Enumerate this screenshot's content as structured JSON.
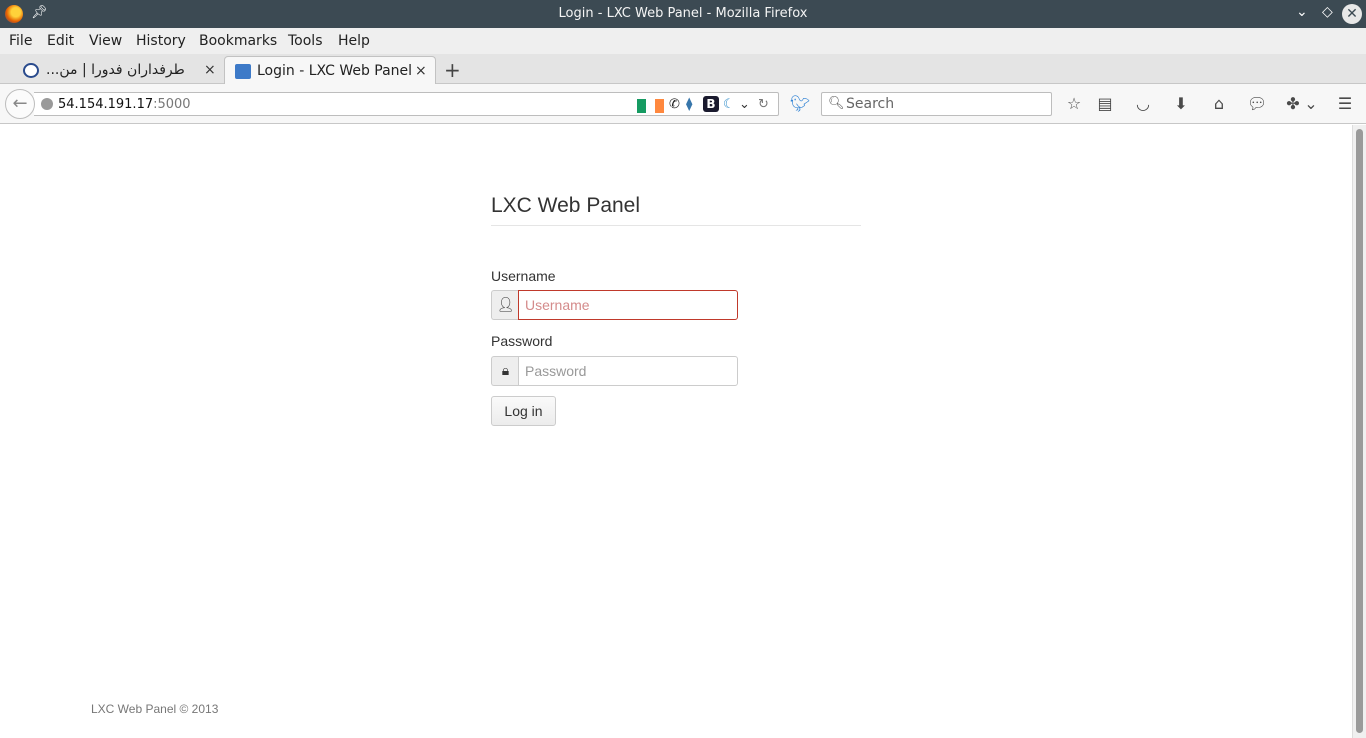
{
  "window": {
    "title": "Login - LXC Web Panel - Mozilla Firefox"
  },
  "menu": {
    "items": [
      "File",
      "Edit",
      "View",
      "History",
      "Bookmarks",
      "Tools",
      "Help"
    ]
  },
  "tabs": [
    {
      "label": "...طرفداران فدورا | من",
      "active": false,
      "close": "×"
    },
    {
      "label": "Login - LXC Web Panel",
      "active": true,
      "close": "×"
    }
  ],
  "navbar": {
    "url_host": "54.154.191.17",
    "url_port": ":5000",
    "search_placeholder": "Search",
    "icons": [
      "back-icon",
      "globe-icon",
      "ireland-flag-icon",
      "phone-icon",
      "python-icon",
      "b-icon",
      "moon-icon",
      "dropdown-icon",
      "reload-icon",
      "bird-icon",
      "search-icon",
      "bookmark-star-icon",
      "reading-list-icon",
      "pocket-icon",
      "download-icon",
      "home-icon",
      "chat-icon",
      "extension-icon",
      "hamburger-menu-icon"
    ]
  },
  "page": {
    "heading": "LXC Web Panel",
    "username": {
      "label": "Username",
      "placeholder": "Username",
      "value": ""
    },
    "password": {
      "label": "Password",
      "placeholder": "Password",
      "value": ""
    },
    "login_button": "Log in",
    "footer": "LXC Web Panel © 2013"
  },
  "colors": {
    "titlebar": "#3c4a53",
    "error_border": "#c0392b"
  }
}
